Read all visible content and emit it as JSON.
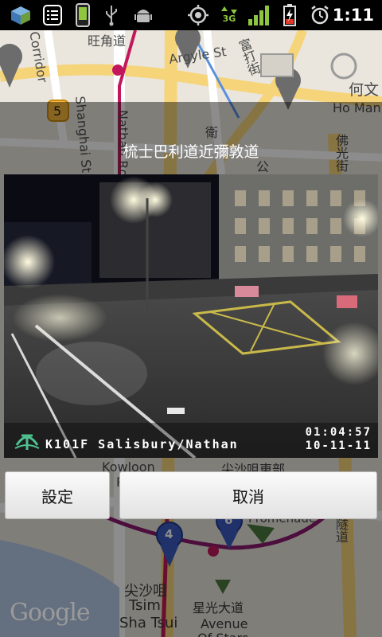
{
  "status_bar": {
    "icons": [
      "launcher-app-icon",
      "notes-icon",
      "phone-device-icon",
      "usb-icon",
      "android-debug-icon",
      "gps-icon",
      "3g-data-icon",
      "signal-icon",
      "battery-charging-icon",
      "alarm-icon"
    ],
    "network_label": "3G",
    "time": "1:11"
  },
  "map": {
    "labels": {
      "corridor": "Corridor",
      "wong_kok": "旺角道",
      "argyle": "Argyle St",
      "fu_choi": "富打街",
      "ho_man_cn": "何文",
      "ho_man": "Ho Man",
      "shanghai": "Shanghai St",
      "nathan": "Nathan Rd",
      "wai": "衛",
      "gong": "公",
      "fat_kwong": "佛光街",
      "route_5": "5",
      "kowloon": "Kowloon",
      "park": "P",
      "tst_east": "尖沙咀東部",
      "promenade": "Promenade",
      "tunnel": "海底隧道",
      "tst_cn": "尖沙咀",
      "tsim": "Tsim",
      "sha_tsui": "Sha Tsui",
      "avenue_cn": "星光大道",
      "avenue": "Avenue",
      "of_stars": "Of Stars",
      "marker_4": "4",
      "marker_6": "6"
    },
    "google": "Google"
  },
  "dialog": {
    "title": "梳士巴利道近彌敦道",
    "camera": {
      "caption": "K101F Salisbury/Nathan",
      "time": "01:04:57",
      "date": "10-11-11"
    },
    "buttons": {
      "settings": "設定",
      "cancel": "取消"
    }
  },
  "colors": {
    "status_bar": "#000000",
    "signal_green": "#8ec63f",
    "battery_red": "#e03a2b",
    "road_yellow": "#f6d47a",
    "mtr_red": "#c2185b",
    "marker_blue": "#3b5bbf"
  }
}
